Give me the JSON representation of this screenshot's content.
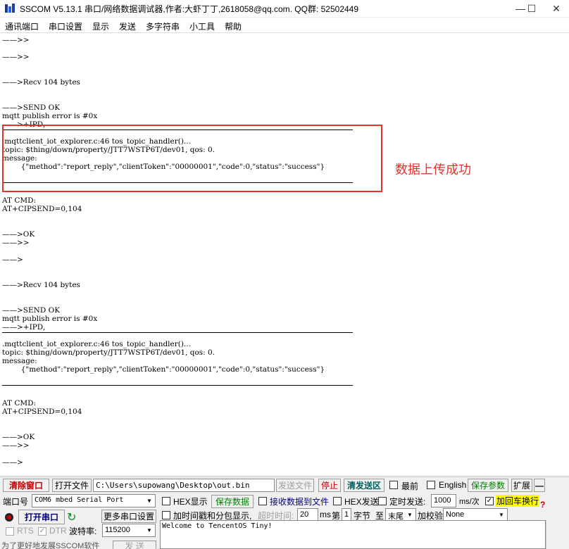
{
  "window": {
    "title": "SSCOM V5.13.1 串口/网络数据调试器,作者:大虾丁丁,2618058@qq.com. QQ群: 52502449",
    "minimize": "—",
    "maximize": "☐",
    "close": "✕"
  },
  "menu": [
    "通讯端口",
    "串口设置",
    "显示",
    "发送",
    "多字符串",
    "小工具",
    "帮助"
  ],
  "log": {
    "lines": [
      "——>>",
      "——>>",
      "——>Recv 104 bytes",
      "——>SEND OK",
      "mqtt publish error is #0x",
      "——>+IPD,",
      " mqttclient_iot_explorer.c:46 tos_topic_handler()...",
      "topic: $thing/down/property/JTT7WSTP6T/dev01, qos: 0.",
      "message:",
      "        {\"method\":\"report_reply\",\"clientToken\":\"00000001\",\"code\":0,\"status\":\"success\"}",
      "AT CMD:",
      "AT+CIPSEND=0,104",
      "——>OK",
      "——>>",
      "——>",
      "——>Recv 104 bytes",
      "——>SEND OK",
      "mqtt publish error is #0x",
      "——>+IPD,",
      ".mqttclient_iot_explorer.c:46 tos_topic_handler()...",
      "topic: $thing/down/property/JTT7WSTP6T/dev01, qos: 0.",
      "message:",
      "        {\"method\":\"report_reply\",\"clientToken\":\"00000001\",\"code\":0,\"status\":\"success\"}",
      "AT CMD:",
      "AT+CIPSEND=0,104",
      "——>OK",
      "——>>",
      "——>"
    ],
    "annotation": "数据上传成功",
    "highlight_color": "#e8322e"
  },
  "toolbar": {
    "clear_window": "清除窗口",
    "open_file": "打开文件",
    "file_path": "C:\\Users\\supowang\\Desktop\\out.bin",
    "send_file": "发送文件",
    "stop": "停止",
    "clear_send": "清发送区",
    "topmost": "最前",
    "english": "English",
    "save_params": "保存参数",
    "expand": "扩展",
    "collapse": "—"
  },
  "settings": {
    "port_label": "端口号",
    "port_value": "COM6 mbed Serial Port",
    "hex_display": "HEX显示",
    "save_data": "保存数据",
    "receive_to_file": "接收数据到文件",
    "hex_send": "HEX发送",
    "timed_send": "定时发送:",
    "interval_value": "1000",
    "interval_unit": "ms/次",
    "add_crlf": "加回车换行",
    "open_port": "打开串口",
    "more_settings": "更多串口设置",
    "timestamp": "加时间戳和分包显示,",
    "timeout_label": "超时时间:",
    "timeout_value": "20",
    "ms": "ms",
    "nth": "第",
    "byte_index": "1",
    "byte_unit": "字节",
    "to": "至",
    "end_value": "末尾",
    "checksum_label": "加校验",
    "checksum_value": "None",
    "rts": "RTS",
    "dtr": "DTR",
    "baud_label": "波特率:",
    "baud_value": "115200",
    "send_text": "Welcome to TencentOS Tiny!",
    "promo": "为了更好地发展SSCOM软件",
    "send_button": "发 送",
    "help_icon": "?"
  }
}
